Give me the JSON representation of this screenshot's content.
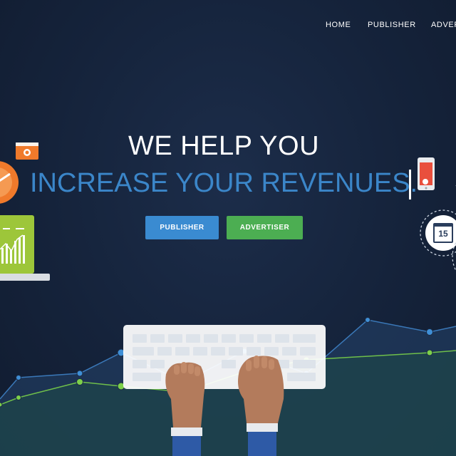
{
  "nav": {
    "items": [
      {
        "label": "HOME"
      },
      {
        "label": "PUBLISHER"
      },
      {
        "label": "ADVERTISER"
      }
    ]
  },
  "hero": {
    "line1": "WE HELP YOU",
    "line2": "INCREASE YOUR REVENUES."
  },
  "buttons": {
    "publisher": "PUBLISHER",
    "advertiser": "ADVERTISER"
  },
  "calendar": {
    "day": "15"
  },
  "colors": {
    "background": "#15223a",
    "accent_blue": "#3b86c9",
    "publisher_button": "#3a8bd1",
    "advertiser_button": "#4cae52",
    "laptop_screen": "#9dc63a",
    "orange": "#f07a2b"
  },
  "icons": [
    "speedometer-icon",
    "camera-card-icon",
    "laptop-chart-icon",
    "smartphone-icon",
    "calendar-icon",
    "keyboard-icon",
    "hands-icon"
  ]
}
